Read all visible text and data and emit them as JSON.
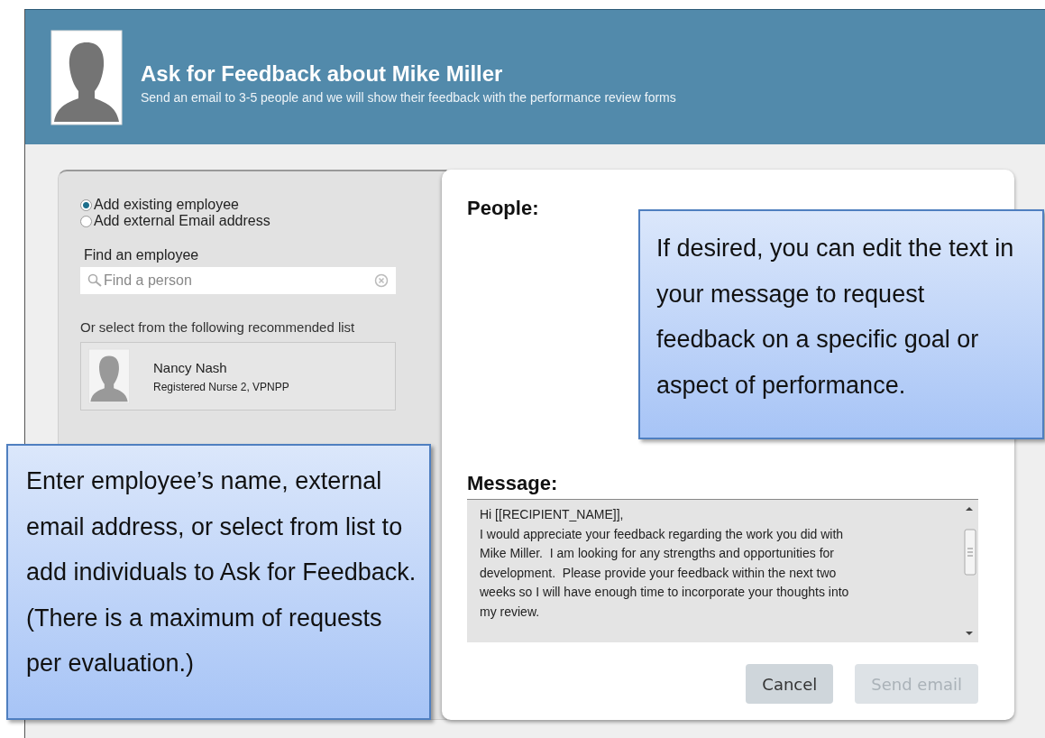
{
  "header": {
    "title": "Ask for Feedback about Mike Miller",
    "subtitle": "Send an email to 3-5 people and we will show their feedback with the performance review forms"
  },
  "add_options": [
    {
      "label": "Add existing employee",
      "selected": true
    },
    {
      "label": "Add external Email address",
      "selected": false
    }
  ],
  "find": {
    "label": "Find an employee",
    "placeholder": "Find a person"
  },
  "recommended": {
    "label": "Or select from the following recommended list",
    "people": [
      {
        "name": "Nancy Nash",
        "role": "Registered Nurse 2, VPNPP"
      }
    ]
  },
  "people": {
    "heading": "People:"
  },
  "message": {
    "heading": "Message:",
    "value": "Hi [[RECIPIENT_NAME]],\nI would appreciate your feedback regarding the work you did with\nMike Miller.  I am looking for any strengths and opportunities for\ndevelopment.  Please provide your feedback within the next two\nweeks so I will have enough time to incorporate your thoughts into\nmy review."
  },
  "buttons": [
    {
      "label": "Cancel",
      "disabled": false
    },
    {
      "label": "Send email",
      "disabled": true
    }
  ],
  "callouts": [
    {
      "text": "If desired, you can edit the text in your message to request feedback on a specific goal or aspect of performance.",
      "kind": "right"
    },
    {
      "text": "Enter employee’s name, external email address, or select from list to add individuals to Ask for Feedback. (There is a maximum of requests per evaluation.)",
      "kind": "left"
    }
  ]
}
